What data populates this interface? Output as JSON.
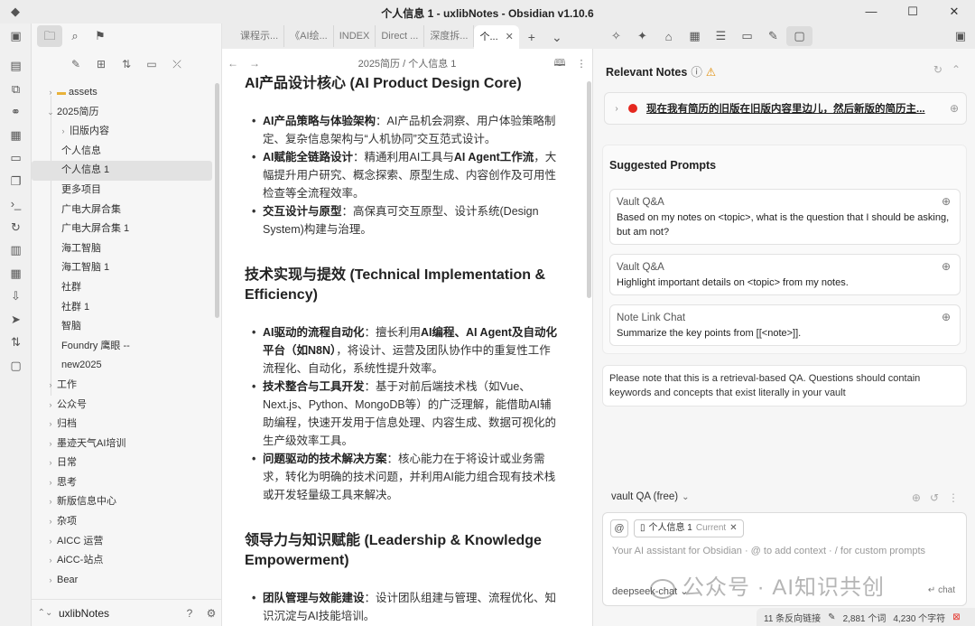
{
  "window": {
    "title": "个人信息 1 - uxlibNotes - Obsidian v1.10.6",
    "controls": [
      "—",
      "☐",
      "✕"
    ]
  },
  "ribbon": {
    "icons": [
      "file-explorer-icon",
      "quick-switcher-icon",
      "graph-view-icon",
      "canvas-icon",
      "calendar-icon",
      "templates-icon",
      "command-palette-icon",
      "sync-icon",
      "table-icon",
      "table-view-icon",
      "import-icon",
      "send-icon",
      "sort-icon",
      "chat-icon"
    ]
  },
  "left_sidebar": {
    "tree": [
      {
        "label": "assets",
        "level": 0,
        "kind": "folder-collapsed",
        "emoji": true
      },
      {
        "label": "2025简历",
        "level": 0,
        "kind": "folder-open"
      },
      {
        "label": "旧版内容",
        "level": 1,
        "kind": "folder-collapsed"
      },
      {
        "label": "个人信息",
        "level": 1,
        "kind": "file"
      },
      {
        "label": "个人信息 1",
        "level": 1,
        "kind": "file",
        "selected": true
      },
      {
        "label": "更多项目",
        "level": 1,
        "kind": "file"
      },
      {
        "label": "广电大屏合集",
        "level": 1,
        "kind": "file"
      },
      {
        "label": "广电大屏合集 1",
        "level": 1,
        "kind": "file"
      },
      {
        "label": "海工智脑",
        "level": 1,
        "kind": "file"
      },
      {
        "label": "海工智脑 1",
        "level": 1,
        "kind": "file"
      },
      {
        "label": "社群",
        "level": 1,
        "kind": "file"
      },
      {
        "label": "社群 1",
        "level": 1,
        "kind": "file"
      },
      {
        "label": "智脑",
        "level": 1,
        "kind": "file"
      },
      {
        "label": "Foundry 鹰眼 --",
        "level": 1,
        "kind": "file"
      },
      {
        "label": "new2025",
        "level": 1,
        "kind": "file"
      },
      {
        "label": "工作",
        "level": 0,
        "kind": "folder-collapsed"
      },
      {
        "label": "公众号",
        "level": 0,
        "kind": "folder-collapsed"
      },
      {
        "label": "归档",
        "level": 0,
        "kind": "folder-collapsed"
      },
      {
        "label": "墨迹天气AI培训",
        "level": 0,
        "kind": "folder-collapsed"
      },
      {
        "label": "日常",
        "level": 0,
        "kind": "folder-collapsed"
      },
      {
        "label": "思考",
        "level": 0,
        "kind": "folder-collapsed"
      },
      {
        "label": "新版信息中心",
        "level": 0,
        "kind": "folder-collapsed"
      },
      {
        "label": "杂项",
        "level": 0,
        "kind": "folder-collapsed"
      },
      {
        "label": "AICC 运营",
        "level": 0,
        "kind": "folder-collapsed"
      },
      {
        "label": "AiCC-站点",
        "level": 0,
        "kind": "folder-collapsed"
      },
      {
        "label": "Bear",
        "level": 0,
        "kind": "folder-collapsed"
      }
    ],
    "vault_name": "uxlibNotes"
  },
  "tabs": [
    {
      "label": "课程示..."
    },
    {
      "label": "《AI绘..."
    },
    {
      "label": "INDEX"
    },
    {
      "label": "Direct ..."
    },
    {
      "label": "深度拆..."
    },
    {
      "label": "个...",
      "active": true
    }
  ],
  "editor": {
    "breadcrumb": "2025简历 / 个人信息 1",
    "sections": [
      {
        "heading": "AI产品设计核心 (AI Product Design Core)",
        "items": [
          {
            "bold": "AI产品策略与体验架构",
            "text": "：AI产品机会洞察、用户体验策略制定、复杂信息架构与“人机协同”交互范式设计。"
          },
          {
            "bold": "AI赋能全链路设计",
            "text_a": "：精通利用AI工具与",
            "bold2": "AI Agent工作流",
            "text": "，大幅提升用户研究、概念探索、原型生成、内容创作及可用性检查等全流程效率。"
          },
          {
            "bold": "交互设计与原型",
            "text": "：高保真可交互原型、设计系统(Design System)构建与治理。"
          }
        ]
      },
      {
        "heading": "技术实现与提效 (Technical Implementation & Efficiency)",
        "items": [
          {
            "bold": "AI驱动的流程自动化",
            "text_a": "：擅长利用",
            "bold2": "AI编程、AI Agent及自动化平台（如N8N）",
            "text": "，将设计、运营及团队协作中的重复性工作流程化、自动化，系统性提升效率。"
          },
          {
            "bold": "技术整合与工具开发",
            "text": "：基于对前后端技术栈（如Vue、Next.js、Python、MongoDB等）的广泛理解，能借助AI辅助编程，快速开发用于信息处理、内容生成、数据可视化的生产级效率工具。"
          },
          {
            "bold": "问题驱动的技术解决方案",
            "text": "：核心能力在于将设计或业务需求，转化为明确的技术问题，并利用AI能力组合现有技术栈或开发轻量级工具来解决。"
          }
        ]
      },
      {
        "heading": "领导力与知识赋能 (Leadership & Knowledge Empowerment)",
        "items": [
          {
            "bold": "团队管理与效能建设",
            "text": "：设计团队组建与管理、流程优化、知识沉淀与AI技能培训。"
          }
        ]
      }
    ]
  },
  "right_pane": {
    "relevant_notes_title": "Relevant Notes",
    "relevant_note_link": "现在我有简历的旧版在旧版内容里边儿，然后新版的简历主...",
    "suggested_prompts_title": "Suggested Prompts",
    "prompts": [
      {
        "type": "Vault Q&A",
        "text": "Based on my notes on <topic>, what is the question that I should be asking, but am not?"
      },
      {
        "type": "Vault Q&A",
        "text": "Highlight important details on <topic> from my notes."
      },
      {
        "type": "Note Link Chat",
        "text": "Summarize the key points from [[<note>]]."
      }
    ],
    "notice": "Please note that this is a retrieval-based QA. Questions should contain keywords and concepts that exist literally in your vault",
    "mode": "vault QA (free)",
    "context_chip": "个人信息 1",
    "context_chip_current": "Current",
    "input_placeholder": "Your AI assistant for Obsidian · @ to add context · / for custom prompts",
    "model": "deepseek-chat",
    "send_label": "chat"
  },
  "watermark": "公众号 · AI知识共创",
  "status_bar": {
    "backlinks": "11 条反向链接",
    "words": "2,881 个词",
    "chars": "4,230 个字符"
  }
}
